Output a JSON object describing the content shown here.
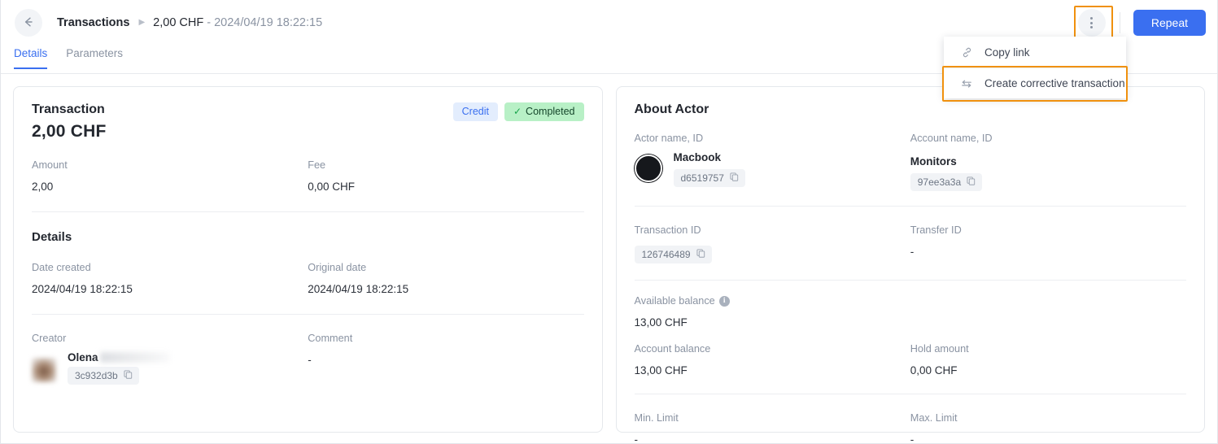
{
  "header": {
    "back_icon": "arrow-left-icon",
    "breadcrumb_root": "Transactions",
    "breadcrumb_separator": "▶",
    "breadcrumb_current_main": "2,00 CHF",
    "breadcrumb_current_muted": " - 2024/04/19 18:22:15",
    "kebab_icon": "kebab-menu-icon",
    "repeat_label": "Repeat"
  },
  "tabs": [
    {
      "label": "Details",
      "active": true
    },
    {
      "label": "Parameters",
      "active": false
    }
  ],
  "menu": {
    "items": [
      {
        "label": "Copy link",
        "icon": "link-icon",
        "highlighted": false
      },
      {
        "label": "Create corrective transaction",
        "icon": "swap-arrows-icon",
        "highlighted": true
      }
    ]
  },
  "transaction_card": {
    "title": "Transaction",
    "amount": "2,00 CHF",
    "badges": [
      {
        "label": "Credit",
        "kind": "credit"
      },
      {
        "label": "Completed",
        "kind": "completed",
        "check": "✓"
      }
    ],
    "amount_label": "Amount",
    "amount_value": "2,00",
    "fee_label": "Fee",
    "fee_value": "0,00 CHF",
    "details_title": "Details",
    "date_created_label": "Date created",
    "date_created_value": "2024/04/19 18:22:15",
    "original_date_label": "Original date",
    "original_date_value": "2024/04/19 18:22:15",
    "creator_label": "Creator",
    "creator_name": "Olena",
    "creator_id": "3c932d3b",
    "comment_label": "Comment",
    "comment_value": "-"
  },
  "actor_card": {
    "title": "About Actor",
    "actor_label": "Actor name, ID",
    "actor_name": "Macbook",
    "actor_id": "d6519757",
    "account_label": "Account name, ID",
    "account_name": "Monitors",
    "account_id": "97ee3a3a",
    "transaction_id_label": "Transaction ID",
    "transaction_id_value": "126746489",
    "transfer_id_label": "Transfer ID",
    "transfer_id_value": "-",
    "available_balance_label": "Available balance",
    "available_balance_info": "i",
    "available_balance_value": "13,00 CHF",
    "account_balance_label": "Account balance",
    "account_balance_value": "13,00 CHF",
    "hold_amount_label": "Hold amount",
    "hold_amount_value": "0,00 CHF",
    "min_limit_label": "Min. Limit",
    "min_limit_value": "-",
    "max_limit_label": "Max. Limit",
    "max_limit_value": "-"
  },
  "colors": {
    "accent_blue": "#3a6ff0",
    "highlight_orange": "#f0910e",
    "badge_credit_bg": "#e3edfd",
    "badge_completed_bg": "#b8f0c6",
    "chip_bg": "#f1f3f6",
    "label_gray": "#8a93a2"
  }
}
